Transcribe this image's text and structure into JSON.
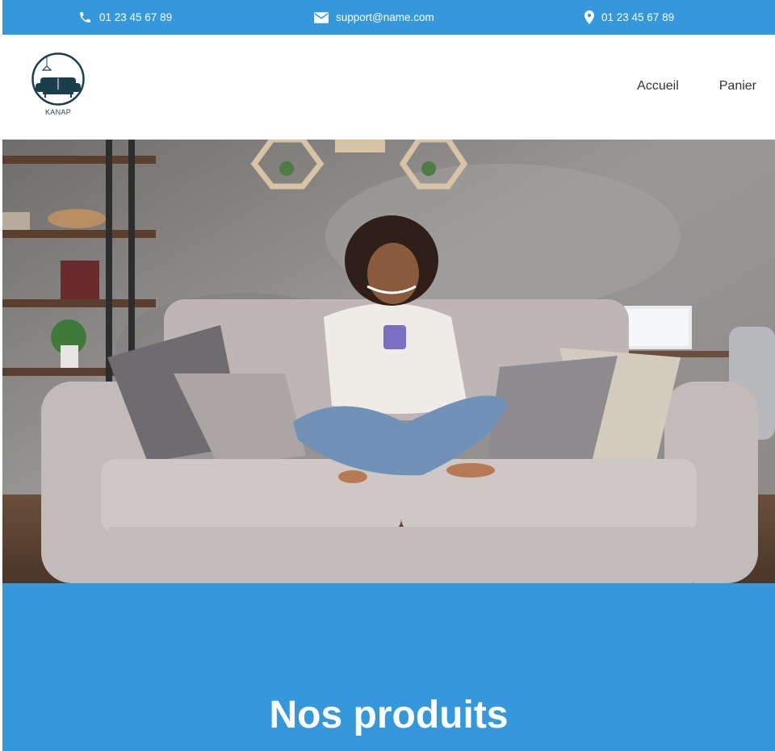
{
  "topbar": {
    "phone": "01 23 45 67 89",
    "email": "support@name.com",
    "address": "01 23 45 67 89",
    "icons": [
      "phone-icon",
      "envelope-icon",
      "map-pin-icon"
    ],
    "background": "#3498db"
  },
  "header": {
    "logo_text": "KANAP",
    "nav": [
      "Accueil",
      "Panier"
    ]
  },
  "hero": {
    "image": "woman-on-sofa-with-phone"
  },
  "products": {
    "title": "Nos produits",
    "background": "#3498db"
  }
}
